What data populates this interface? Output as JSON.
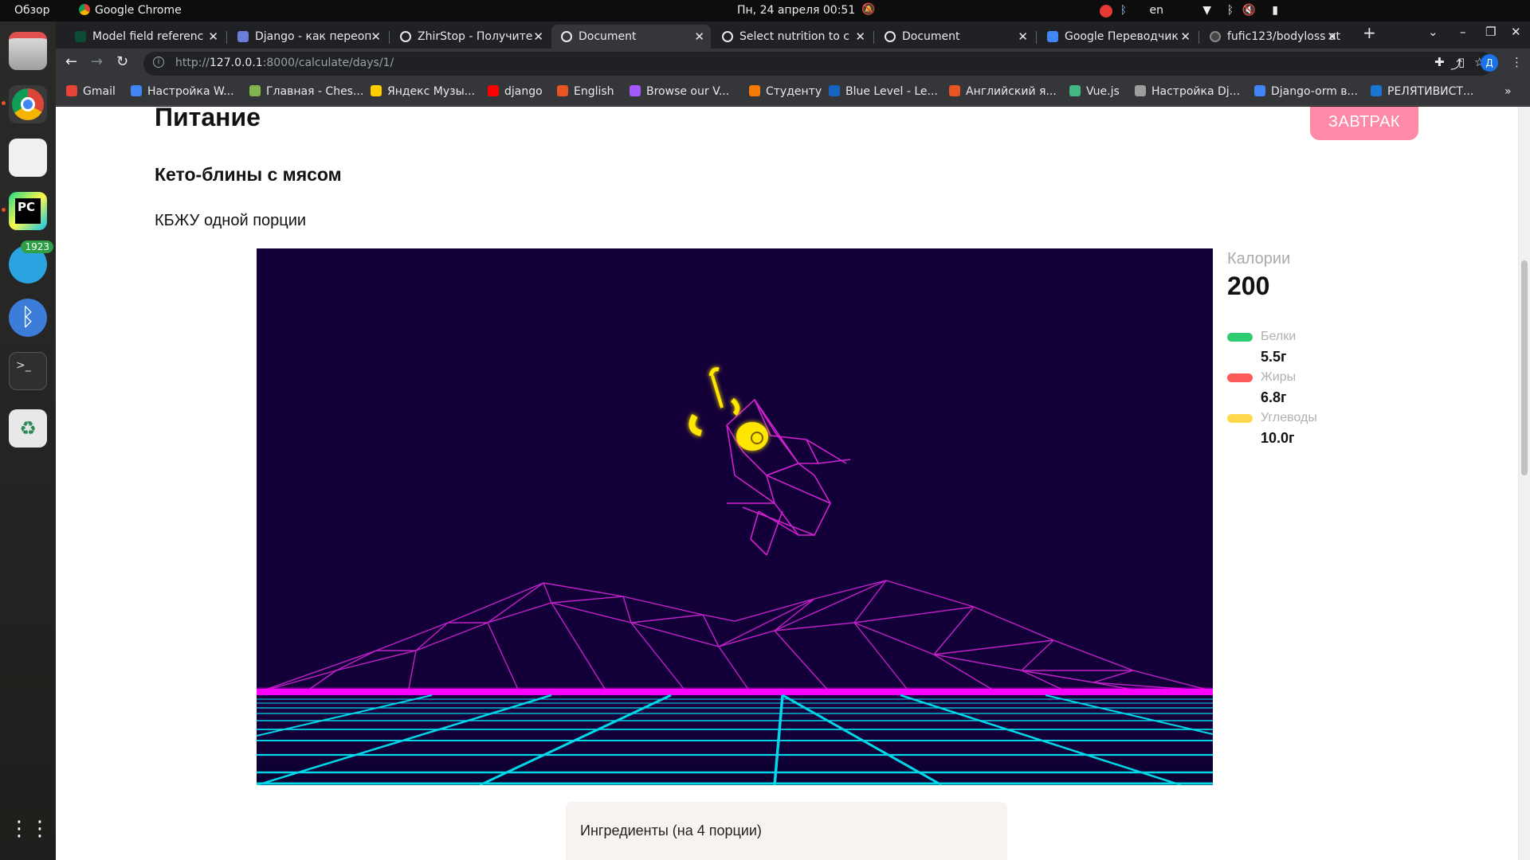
{
  "system_bar": {
    "activities": "Обзор",
    "app_name": "Google Chrome",
    "clock": "Пн, 24 апреля  00:51",
    "keyboard_layout": "en"
  },
  "dock": {
    "telegram_badge": "1923"
  },
  "browser": {
    "tabs": [
      {
        "title": "Model field referenc",
        "icon": "django-icon"
      },
      {
        "title": "Django - как переоп",
        "icon": "stackoverflow-icon"
      },
      {
        "title": "ZhirStop - Получите",
        "icon": "globe-icon"
      },
      {
        "title": "Document",
        "icon": "globe-icon",
        "active": true
      },
      {
        "title": "Select nutrition to c",
        "icon": "globe-icon"
      },
      {
        "title": "Document",
        "icon": "globe-icon"
      },
      {
        "title": "Google Переводчик",
        "icon": "translate-icon"
      },
      {
        "title": "fufic123/bodyloss at",
        "icon": "github-icon"
      }
    ],
    "url_prefix": "http://",
    "url_host": "127.0.0.1",
    "url_path": ":8000/calculate/days/1/",
    "profile_initial": "Д",
    "bookmarks": [
      {
        "label": "Gmail",
        "color": "#ea4335"
      },
      {
        "label": "Настройка W...",
        "color": "#4285f4"
      },
      {
        "label": "Главная - Ches...",
        "color": "#81b64c"
      },
      {
        "label": "Яндекс Музы...",
        "color": "#ffcc00"
      },
      {
        "label": "django",
        "color": "#ff0000"
      },
      {
        "label": "English",
        "color": "#e95420"
      },
      {
        "label": "Browse our V...",
        "color": "#a259ff"
      },
      {
        "label": "Студенту",
        "color": "#f57c00"
      },
      {
        "label": "Blue Level - Le...",
        "color": "#1565c0"
      },
      {
        "label": "Английский я...",
        "color": "#e95420"
      },
      {
        "label": "Vue.js",
        "color": "#42b883"
      },
      {
        "label": "Настройка Dj...",
        "color": "#9e9e9e"
      },
      {
        "label": "Django-orm в...",
        "color": "#4285f4"
      },
      {
        "label": "РЕЛЯТИВИСТ...",
        "color": "#1976d2"
      }
    ]
  },
  "page": {
    "title": "Питание",
    "meal_button": "ЗАВТРАК",
    "recipe_title": "Кето-блины с мясом",
    "subtitle": "КБЖУ одной порции",
    "calories_label": "Калории",
    "calories_value": "200",
    "macros": [
      {
        "name": "Белки",
        "value": "5.5г",
        "color": "#2ecc71"
      },
      {
        "name": "Жиры",
        "value": "6.8г",
        "color": "#ff5a5a"
      },
      {
        "name": "Углеводы",
        "value": "10.0г",
        "color": "#ffd84d"
      }
    ],
    "ingredients_header": "Ингредиенты (на 4 порции)"
  },
  "colors": {
    "media_bg": "#140038",
    "neon_magenta": "#ff00ff",
    "neon_cyan": "#00e5ff",
    "accent_pink": "#ff8aa8"
  }
}
